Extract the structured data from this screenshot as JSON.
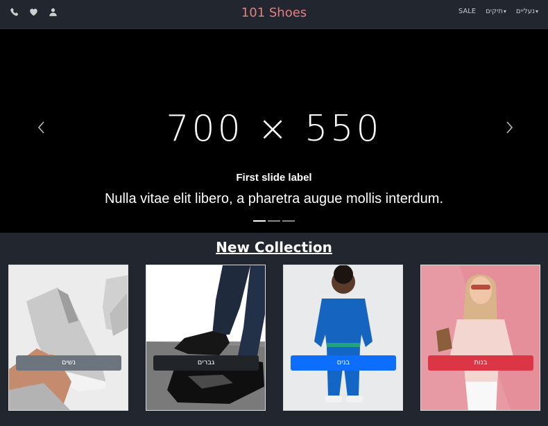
{
  "navbar": {
    "brand": "101 Shoes",
    "icons": [
      "phone-icon",
      "heart-icon",
      "user-icon"
    ],
    "links": [
      {
        "label": "נעליים",
        "dropdown": true
      },
      {
        "label": "תיקים",
        "dropdown": true
      },
      {
        "label": "SALE",
        "dropdown": false
      }
    ]
  },
  "carousel": {
    "placeholder_text": "700 × 550",
    "title": "First slide label",
    "text": "Nulla vitae elit libero, a pharetra augue mollis interdum.",
    "slide_count": 3,
    "active_slide": 1
  },
  "collection": {
    "title": "New Collection",
    "cards": [
      {
        "label": "נשים",
        "button_color": "#6c757d"
      },
      {
        "label": "גברים",
        "button_color": "#212529"
      },
      {
        "label": "בנים",
        "button_color": "#0d6efd"
      },
      {
        "label": "בנות",
        "button_color": "#dc3545"
      }
    ]
  },
  "colors": {
    "background": "#22262f",
    "brand": "#e67f7f",
    "carousel_bg": "#000000"
  }
}
